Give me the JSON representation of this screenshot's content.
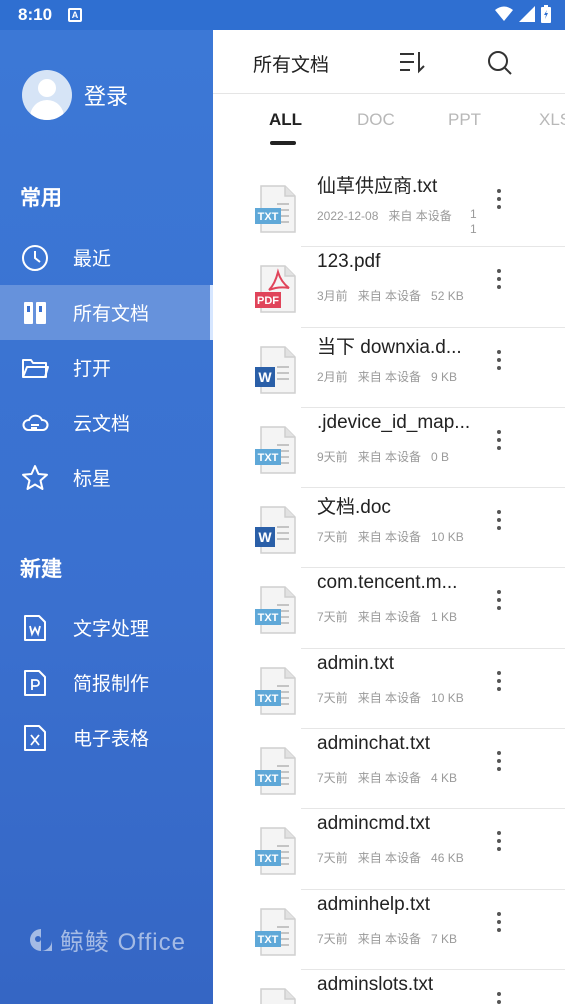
{
  "status": {
    "time": "8:10",
    "notif": "A"
  },
  "drawer": {
    "login_label": "登录",
    "section_common": "常用",
    "nav": [
      {
        "label": "最近",
        "icon": "clock-icon"
      },
      {
        "label": "所有文档",
        "icon": "books-icon"
      },
      {
        "label": "打开",
        "icon": "folder-icon"
      },
      {
        "label": "云文档",
        "icon": "cloud-icon"
      },
      {
        "label": "标星",
        "icon": "star-icon"
      }
    ],
    "section_new": "新建",
    "create": [
      {
        "label": "文字处理",
        "icon": "word-doc-icon"
      },
      {
        "label": "简报制作",
        "icon": "ppt-doc-icon"
      },
      {
        "label": "电子表格",
        "icon": "excel-doc-icon"
      }
    ],
    "brand": "鲸鲮 Office"
  },
  "main": {
    "title": "所有文档",
    "tabs": [
      "ALL",
      "DOC",
      "PPT",
      "XLS"
    ],
    "files": [
      {
        "name": "仙草供应商.txt",
        "date": "2022-12-08",
        "source": "来自 本设备",
        "size": "1 1",
        "type": "TXT"
      },
      {
        "name": "123.pdf",
        "date": "3月前",
        "source": "来自 本设备",
        "size": "52 KB",
        "type": "PDF"
      },
      {
        "name": "当下 downxia.d...",
        "date": "2月前",
        "source": "来自 本设备",
        "size": "9 KB",
        "type": "W"
      },
      {
        "name": ".jdevice_id_map...",
        "date": "9天前",
        "source": "来自 本设备",
        "size": "0 B",
        "type": "TXT"
      },
      {
        "name": "文档.doc",
        "date": "7天前",
        "source": "来自 本设备",
        "size": "10 KB",
        "type": "W"
      },
      {
        "name": "com.tencent.m...",
        "date": "7天前",
        "source": "来自 本设备",
        "size": "1 KB",
        "type": "TXT"
      },
      {
        "name": "admin.txt",
        "date": "7天前",
        "source": "来自 本设备",
        "size": "10 KB",
        "type": "TXT"
      },
      {
        "name": "adminchat.txt",
        "date": "7天前",
        "source": "来自 本设备",
        "size": "4 KB",
        "type": "TXT"
      },
      {
        "name": "admincmd.txt",
        "date": "7天前",
        "source": "来自 本设备",
        "size": "46 KB",
        "type": "TXT"
      },
      {
        "name": "adminhelp.txt",
        "date": "7天前",
        "source": "来自 本设备",
        "size": "7 KB",
        "type": "TXT"
      },
      {
        "name": "adminslots.txt",
        "date": "",
        "source": "",
        "size": "",
        "type": "TXT"
      }
    ]
  },
  "colors": {
    "drawer": "#3a70cf",
    "txt": "#5fa8d8",
    "pdf": "#e0445a",
    "word": "#2a5fa8"
  }
}
